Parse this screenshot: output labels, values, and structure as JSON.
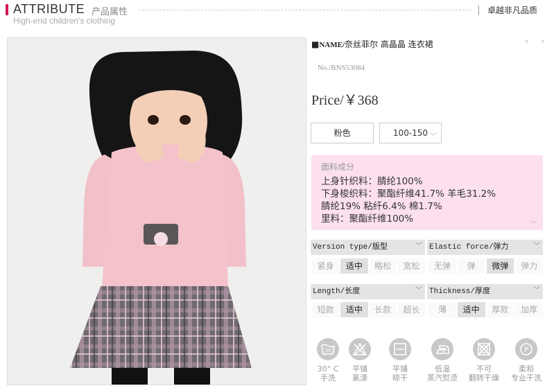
{
  "header": {
    "title": "ATTRIBUTE",
    "title_cn": "产品属性",
    "subtitle": "High-end children's clothing",
    "slogan": "卓越非凡品质"
  },
  "product": {
    "name_prefix": "NAME/",
    "name": "奈丝菲尔 高晶晶 连衣裙",
    "sku": "No./BNS53084",
    "price": "Price/￥368",
    "color": "粉色",
    "size": "100-150"
  },
  "fabric": {
    "title": "面料成分",
    "lines": [
      "上身针织料：腈纶100%",
      "下身梭织料：聚酯纤维41.7%  羊毛31.2%",
      "腈纶19%  粘纤6.4% 棉1.7%",
      "里料：聚酯纤维100%"
    ]
  },
  "attributes": [
    {
      "label": "Version type/版型",
      "options": [
        "紧身",
        "适中",
        "略松",
        "宽松"
      ],
      "selected": 1
    },
    {
      "label": "Elastic force/弹力",
      "options": [
        "无弹",
        "弹",
        "微弹",
        "弹力"
      ],
      "selected": 2
    },
    {
      "label": "Length/长度",
      "options": [
        "短款",
        "适中",
        "长款",
        "超长"
      ],
      "selected": 1
    },
    {
      "label": "Thickness/厚度",
      "options": [
        "薄",
        "适中",
        "厚款",
        "加厚"
      ],
      "selected": 1
    }
  ],
  "care": [
    {
      "icon": "wash-30-icon",
      "mark": "30",
      "line1": "30° C",
      "line2": "手洗"
    },
    {
      "icon": "no-bleach-icon",
      "line1": "平铺",
      "line2": "氯漂"
    },
    {
      "icon": "dry-flat-icon",
      "line1": "平铺",
      "line2": "晾干"
    },
    {
      "icon": "iron-low-icon",
      "line1": "低温",
      "line2": "蒸汽熨烫"
    },
    {
      "icon": "no-tumble-dry-icon",
      "line1": "不可",
      "line2": "翻转干燥"
    },
    {
      "icon": "dry-clean-icon",
      "mark": "P",
      "line1": "柔和",
      "line2": "专业干洗"
    }
  ],
  "colors": {
    "accent": "#d4145a",
    "fabric_bg": "#fce0ee",
    "selected": "#e0e0e0",
    "attr_head": "#e4e4e4"
  }
}
